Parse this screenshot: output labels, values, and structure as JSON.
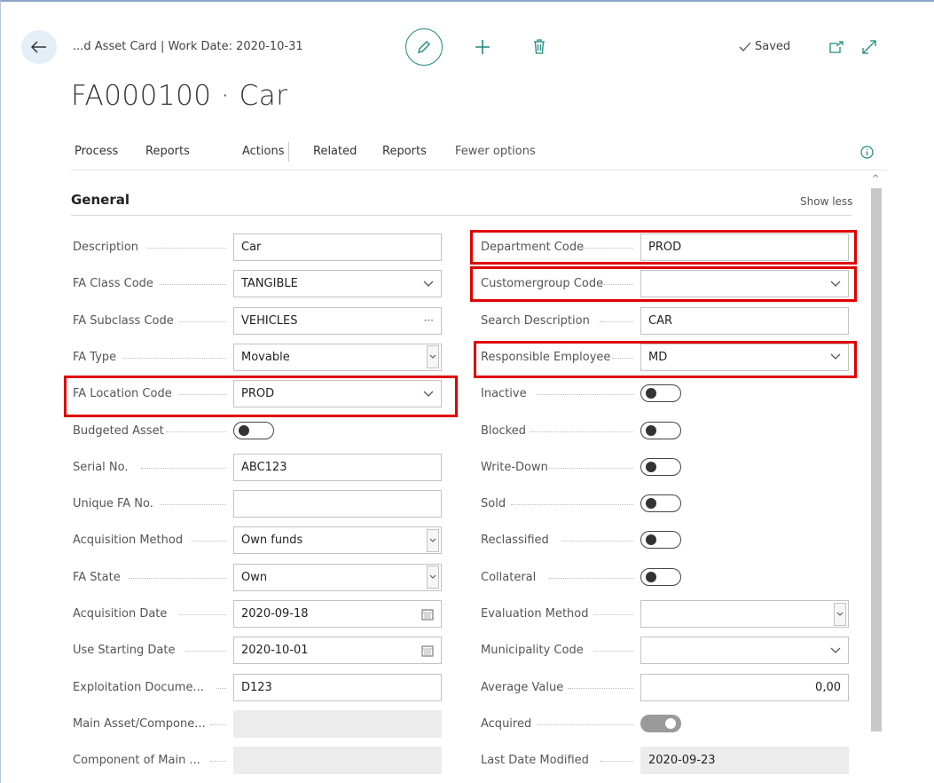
{
  "header": {
    "breadcrumb": "...d Asset Card | Work Date: 2020-10-31",
    "title": "FA000100 · Car",
    "saved_label": "Saved",
    "icons": [
      "back-arrow-icon",
      "pencil-icon",
      "plus-icon",
      "trash-icon",
      "checkmark-icon",
      "open-new-window-icon",
      "expand-icon"
    ]
  },
  "actionbar": {
    "process": "Process",
    "reports1": "Reports",
    "actions": "Actions",
    "related": "Related",
    "reports2": "Reports",
    "fewer": "Fewer options"
  },
  "section": {
    "title": "General",
    "show_less": "Show less"
  },
  "left_fields": [
    {
      "label": "Description",
      "value": "Car",
      "kind": "text"
    },
    {
      "label": "FA Class Code",
      "value": "TANGIBLE",
      "kind": "select"
    },
    {
      "label": "FA Subclass Code",
      "value": "VEHICLES",
      "kind": "lookup",
      "suffix": "···"
    },
    {
      "label": "FA Type",
      "value": "Movable",
      "kind": "boxselect"
    },
    {
      "label": "FA Location Code",
      "value": "PROD",
      "kind": "select"
    },
    {
      "label": "Budgeted Asset",
      "value": "",
      "kind": "toggle"
    },
    {
      "label": "Serial No.",
      "value": "ABC123",
      "kind": "text"
    },
    {
      "label": "Unique FA No.",
      "value": "",
      "kind": "text"
    },
    {
      "label": "Acquisition Method",
      "value": "Own funds",
      "kind": "boxselect"
    },
    {
      "label": "FA State",
      "value": "Own",
      "kind": "boxselect"
    },
    {
      "label": "Acquisition Date",
      "value": "2020-09-18",
      "kind": "date"
    },
    {
      "label": "Use Starting Date",
      "value": "2020-10-01",
      "kind": "date"
    },
    {
      "label": "Exploitation Docume...",
      "value": "D123",
      "kind": "text"
    },
    {
      "label": "Main Asset/Compone...",
      "value": "",
      "kind": "readonly"
    },
    {
      "label": "Component of Main ...",
      "value": "",
      "kind": "readonly"
    }
  ],
  "right_fields": [
    {
      "label": "Department Code",
      "value": "PROD",
      "kind": "text"
    },
    {
      "label": "Customergroup Code",
      "value": "",
      "kind": "select"
    },
    {
      "label": "Search Description",
      "value": "CAR",
      "kind": "text"
    },
    {
      "label": "Responsible Employee",
      "value": "MD",
      "kind": "select"
    },
    {
      "label": "Inactive",
      "value": "",
      "kind": "toggle"
    },
    {
      "label": "Blocked",
      "value": "",
      "kind": "toggle"
    },
    {
      "label": "Write-Down",
      "value": "",
      "kind": "toggle"
    },
    {
      "label": "Sold",
      "value": "",
      "kind": "toggle"
    },
    {
      "label": "Reclassified",
      "value": "",
      "kind": "toggle"
    },
    {
      "label": "Collateral",
      "value": "",
      "kind": "toggle"
    },
    {
      "label": "Evaluation Method",
      "value": "",
      "kind": "boxselect"
    },
    {
      "label": "Municipality Code",
      "value": "",
      "kind": "select"
    },
    {
      "label": "Average Value",
      "value": "0,00",
      "kind": "number"
    },
    {
      "label": "Acquired",
      "value": "",
      "kind": "toggle-on"
    },
    {
      "label": "Last Date Modified",
      "value": "2020-09-23",
      "kind": "readonly"
    }
  ],
  "colors": {
    "accent": "#1f8a7d",
    "highlight": "#e00000",
    "back_button_bg": "#e3eef6"
  }
}
